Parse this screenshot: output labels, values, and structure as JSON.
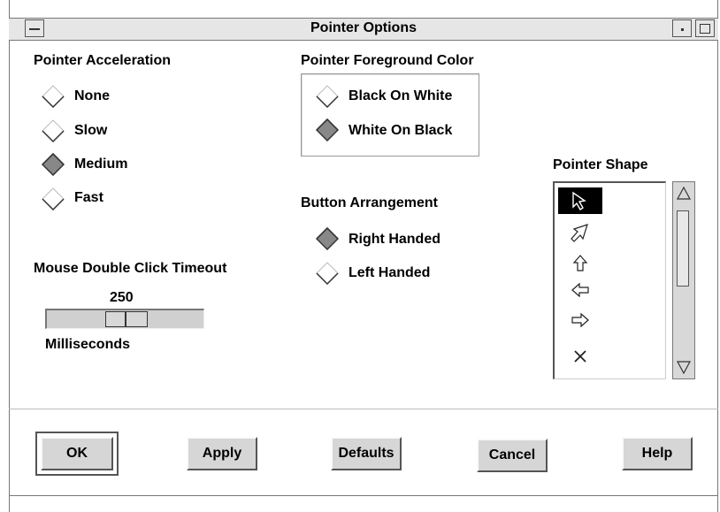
{
  "window": {
    "title": "Pointer Options"
  },
  "acceleration": {
    "label": "Pointer Acceleration",
    "options": [
      "None",
      "Slow",
      "Medium",
      "Fast"
    ],
    "selected": "Medium"
  },
  "foreground": {
    "label": "Pointer Foreground Color",
    "options": [
      "Black On White",
      "White On Black"
    ],
    "selected": "White On Black"
  },
  "buttons_arrangement": {
    "label": "Button Arrangement",
    "options": [
      "Right Handed",
      "Left Handed"
    ],
    "selected": "Right Handed"
  },
  "double_click": {
    "label": "Mouse Double Click Timeout",
    "value": "250",
    "units": "Milliseconds",
    "level": 0.5
  },
  "pointer_shape": {
    "label": "Pointer Shape",
    "items": [
      "arrow-pointer-icon",
      "arrow-upright-icon",
      "arrow-up-icon",
      "arrow-left-icon",
      "arrow-right-icon",
      "x-cross-icon"
    ],
    "selected_index": 0
  },
  "actions": {
    "ok": "OK",
    "apply": "Apply",
    "defaults": "Defaults",
    "cancel": "Cancel",
    "help": "Help"
  },
  "colors": {
    "background": "#ffffff",
    "chrome": "#d6d6d6",
    "selected_diamond": "#777777"
  }
}
